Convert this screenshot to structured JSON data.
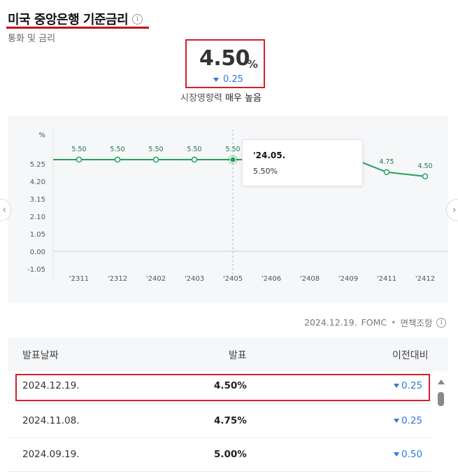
{
  "header": {
    "title": "미국 중앙은행 기준금리",
    "info_icon": "i",
    "subtitle": "통화 및 금리"
  },
  "rate": {
    "value": "4.50",
    "unit": "%",
    "change": "0.25",
    "change_direction": "down",
    "impact_label": "시장영향력",
    "impact_value": "매우 높음"
  },
  "chart_data": {
    "type": "line",
    "unit_label": "%",
    "categories": [
      "'2311",
      "'2312",
      "'2402",
      "'2403",
      "'2405",
      "'2406",
      "'2408",
      "'2409",
      "'2411",
      "'2412"
    ],
    "values": [
      5.5,
      5.5,
      5.5,
      5.5,
      5.5,
      null,
      null,
      null,
      4.75,
      4.5
    ],
    "data_labels": [
      "5.50",
      "5.50",
      "5.50",
      "5.50",
      "5.50",
      "",
      "",
      "",
      "4.75",
      "4.50"
    ],
    "y_ticks": [
      "5.25",
      "4.20",
      "3.15",
      "2.10",
      "1.05",
      "0.00",
      "-1.05"
    ],
    "ylim": [
      -1.05,
      5.25
    ],
    "grid": false,
    "line_color": "#22a05a",
    "zero_line_color": "#a9d4ef",
    "highlight_index": 4
  },
  "tooltip": {
    "date": "'24.05.",
    "value": "5.50%"
  },
  "nav": {
    "left_icon": "chevron-left-icon",
    "right_icon": "chevron-right-icon",
    "left_glyph": "‹",
    "right_glyph": "›"
  },
  "source": {
    "date": "2024.12.19.",
    "org": "FOMC",
    "separator": "•",
    "link": "면책조항",
    "info_icon": "i"
  },
  "table": {
    "headers": {
      "date": "발표날짜",
      "value": "발표",
      "change": "이전대비"
    },
    "rows": [
      {
        "date": "2024.12.19.",
        "value": "4.50%",
        "change": "0.25"
      },
      {
        "date": "2024.11.08.",
        "value": "4.75%",
        "change": "0.25"
      },
      {
        "date": "2024.09.19.",
        "value": "5.00%",
        "change": "0.50"
      }
    ]
  },
  "colors": {
    "accent_red": "#d3202b",
    "down_blue": "#2a7ad8",
    "line_green": "#22a05a"
  }
}
